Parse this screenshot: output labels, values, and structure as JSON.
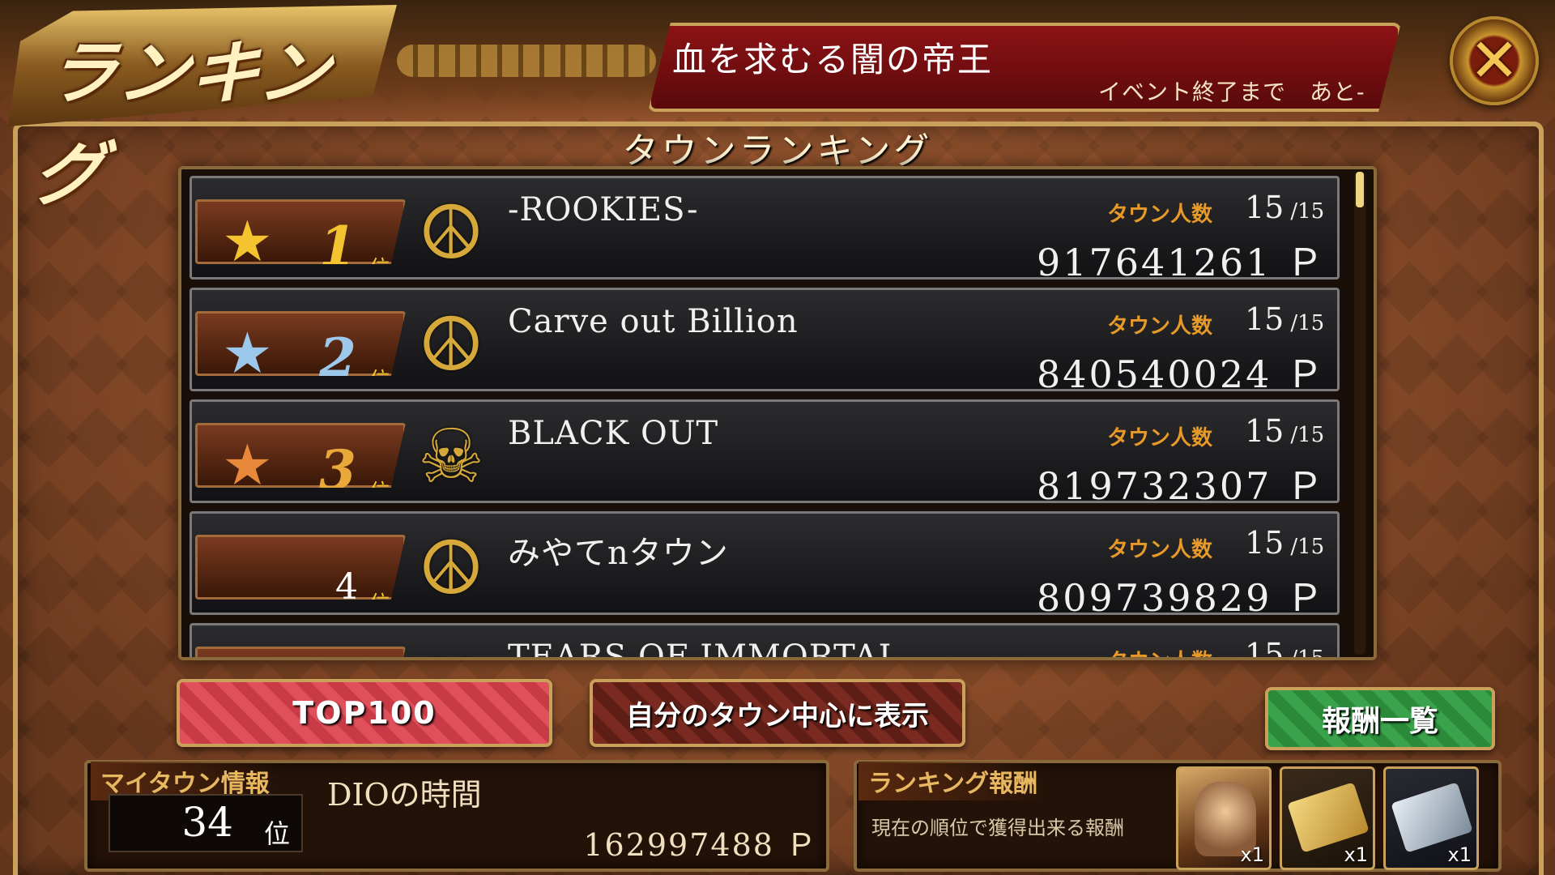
{
  "header": {
    "banner_title": "ランキング",
    "event_title": "血を求むる闇の帝王",
    "event_remaining": "イベント終了まで　あと-",
    "close_symbol": "✕"
  },
  "section_title": "タウンランキング",
  "rankings": [
    {
      "rank": "1",
      "rank_suffix": "位",
      "star": "★",
      "star_color": "#f4c430",
      "emblem": "☮",
      "name": "-ROOKIES-",
      "members_label": "タウン人数",
      "members": "15",
      "members_max": "/15",
      "points": "917641261 ＰＴ"
    },
    {
      "rank": "2",
      "rank_suffix": "位",
      "star": "★",
      "star_color": "#9cc8ec",
      "emblem": "☮",
      "name": "Carve out Billion",
      "members_label": "タウン人数",
      "members": "15",
      "members_max": "/15",
      "points": "840540024 ＰＴ"
    },
    {
      "rank": "3",
      "rank_suffix": "位",
      "star": "★",
      "star_color": "#e8883a",
      "emblem": "☠",
      "name": "BLACK OUT",
      "members_label": "タウン人数",
      "members": "15",
      "members_max": "/15",
      "points": "819732307 ＰＴ"
    },
    {
      "rank": "4",
      "rank_suffix": "位",
      "star": "",
      "star_color": "",
      "emblem": "☮",
      "name": "みやてnタウン",
      "members_label": "タウン人数",
      "members": "15",
      "members_max": "/15",
      "points": "809739829 ＰＴ"
    },
    {
      "rank": "",
      "rank_suffix": "",
      "star": "",
      "star_color": "",
      "emblem": "❤",
      "name": "TEARS OF IMMORTAL",
      "members_label": "タウン人数",
      "members": "15",
      "members_max": "/15",
      "points": ""
    }
  ],
  "buttons": {
    "top100": "TOP100",
    "center_on_my_town": "自分のタウン中心に表示",
    "rewards_list": "報酬一覧"
  },
  "my_town": {
    "label": "マイタウン情報",
    "rank": "34",
    "rank_unit": "位",
    "name": "DIOの時間",
    "points": "162997488 ＰＴ"
  },
  "ranking_rewards": {
    "label": "ランキング報酬",
    "description": "現在の順位で獲得出来る報酬",
    "items": [
      {
        "icon": "character-card-icon",
        "qty": "x1"
      },
      {
        "icon": "gold-ticket-icon",
        "qty": "x1"
      },
      {
        "icon": "silver-ticket-icon",
        "qty": "x1"
      }
    ]
  },
  "colors": {
    "accent_gold": "#c9a15a",
    "event_red": "#8c1215",
    "members_orange": "#e89a28",
    "top_button_pink": "#e0505a",
    "rewards_green": "#3aa24a"
  }
}
